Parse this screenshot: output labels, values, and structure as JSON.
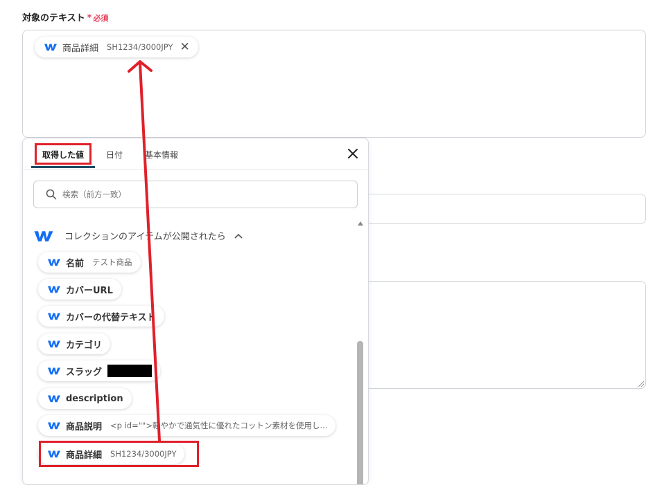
{
  "field": {
    "label": "対象のテキスト",
    "required_mark": "*",
    "required_text": "必須"
  },
  "selected_chip": {
    "label": "商品詳細",
    "value": "SH1234/3000JPY"
  },
  "popup": {
    "tabs": [
      {
        "label": "取得した値"
      },
      {
        "label": "日付"
      },
      {
        "label": "基本情報"
      }
    ],
    "search_placeholder": "検索（前方一致）",
    "group_title": "コレクションのアイテムが公開されたら",
    "items": [
      {
        "label": "名前",
        "value": "テスト商品"
      },
      {
        "label": "カバーURL",
        "value": ""
      },
      {
        "label": "カバーの代替テキスト",
        "value": ""
      },
      {
        "label": "カテゴリ",
        "value": ""
      },
      {
        "label": "スラッグ",
        "value": ""
      },
      {
        "label": "description",
        "value": ""
      },
      {
        "label": "商品説明",
        "value": "<p id=\"\">軽やかで通気性に優れたコットン素材を使用し..."
      },
      {
        "label": "商品詳細",
        "value": "SH1234/3000JPY"
      }
    ]
  },
  "colors": {
    "accent_red": "#e0202b",
    "required": "#e8405a",
    "webflow_blue": "#146ef5",
    "tab_underline": "#1c4b64"
  }
}
